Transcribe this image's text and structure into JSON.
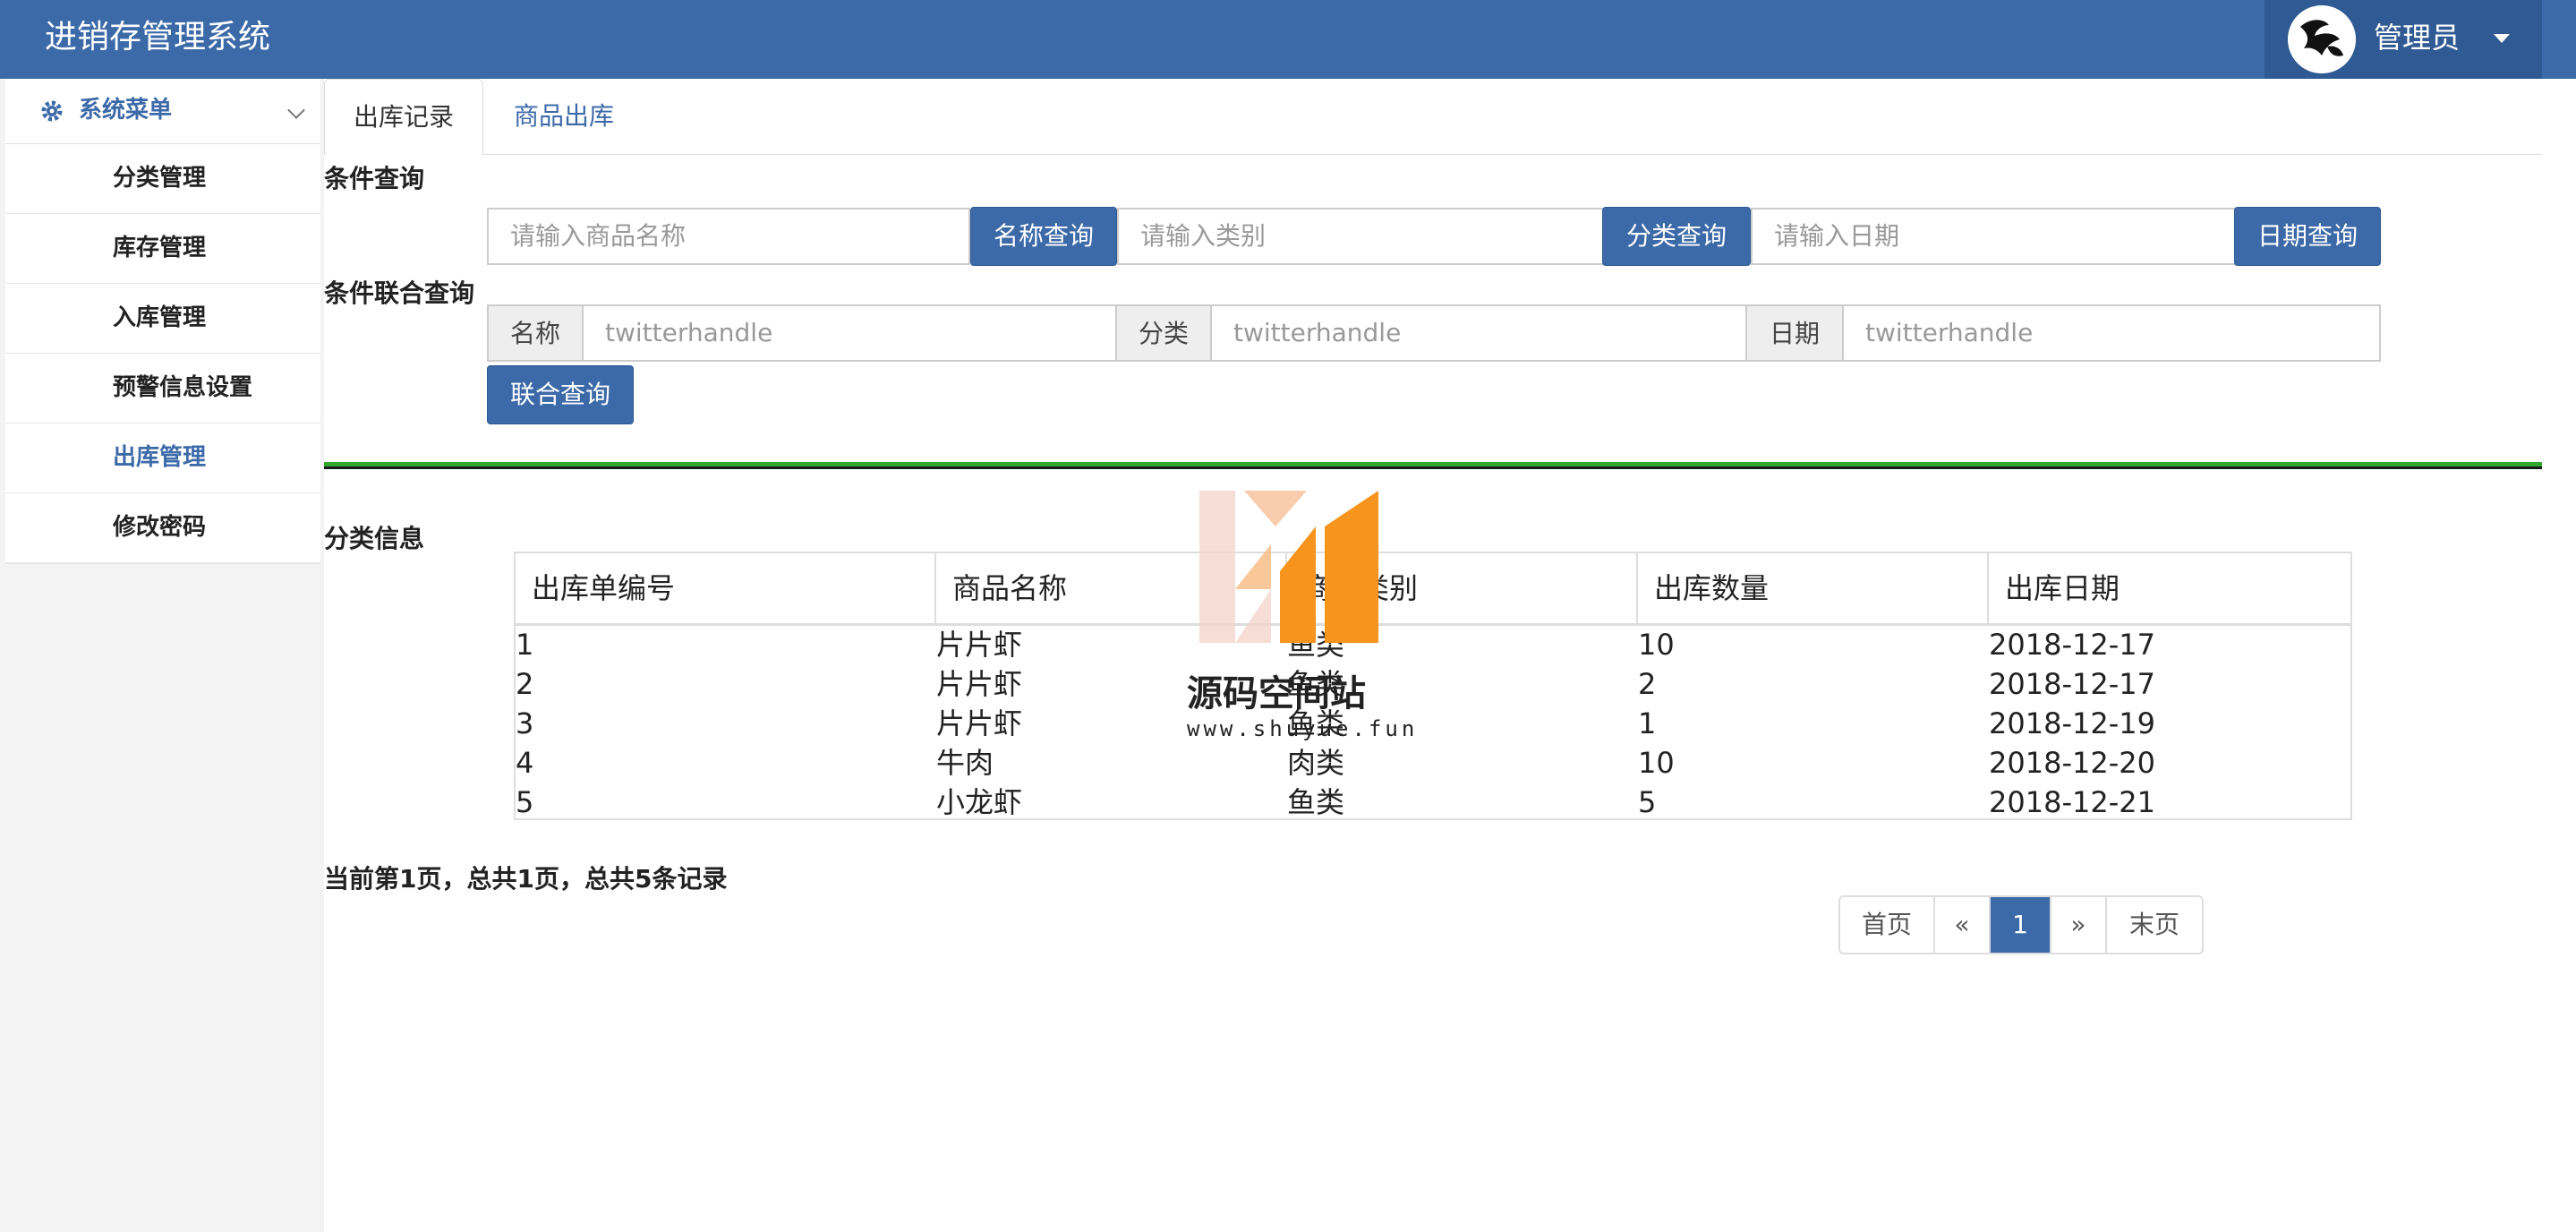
{
  "header": {
    "app_title": "进销存管理系统",
    "user_name": "管理员",
    "icons": {
      "avatar": "avatar-icon",
      "caret": "caret-down-icon"
    }
  },
  "sidebar": {
    "menu_title": "系统菜单",
    "items": [
      {
        "label": "分类管理",
        "active": false
      },
      {
        "label": "库存管理",
        "active": false
      },
      {
        "label": "入库管理",
        "active": false
      },
      {
        "label": "预警信息设置",
        "active": false
      },
      {
        "label": "出库管理",
        "active": true
      },
      {
        "label": "修改密码",
        "active": false
      }
    ]
  },
  "tabs": [
    {
      "label": "出库记录",
      "active": true
    },
    {
      "label": "商品出库",
      "active": false
    }
  ],
  "condition_query": {
    "label": "条件查询",
    "name_placeholder": "请输入商品名称",
    "name_button": "名称查询",
    "category_placeholder": "请输入类别",
    "category_button": "分类查询",
    "date_placeholder": "请输入日期",
    "date_button": "日期查询"
  },
  "combined_query": {
    "label": "条件联合查询",
    "name_addon": "名称",
    "name_placeholder": "twitterhandle",
    "category_addon": "分类",
    "category_placeholder": "twitterhandle",
    "date_addon": "日期",
    "date_placeholder": "twitterhandle",
    "button": "联合查询"
  },
  "table": {
    "title": "分类信息",
    "columns": [
      "出库单编号",
      "商品名称",
      "商品类别",
      "出库数量",
      "出库日期"
    ],
    "rows": [
      [
        "1",
        "片片虾",
        "鱼类",
        "10",
        "2018-12-17"
      ],
      [
        "2",
        "片片虾",
        "鱼类",
        "2",
        "2018-12-17"
      ],
      [
        "3",
        "片片虾",
        "鱼类",
        "1",
        "2018-12-19"
      ],
      [
        "4",
        "牛肉",
        "肉类",
        "10",
        "2018-12-20"
      ],
      [
        "5",
        "小龙虾",
        "鱼类",
        "5",
        "2018-12-21"
      ]
    ]
  },
  "pagination": {
    "info": "当前第1页，总共1页，总共5条记录",
    "first": "首页",
    "prev": "«",
    "current": "1",
    "next": "»",
    "last": "末页"
  },
  "watermark": {
    "text": "源码空间站",
    "url": "www.shuyue.fun"
  },
  "colors": {
    "primary": "#3c6aa8",
    "divider": "#2fa82c"
  }
}
